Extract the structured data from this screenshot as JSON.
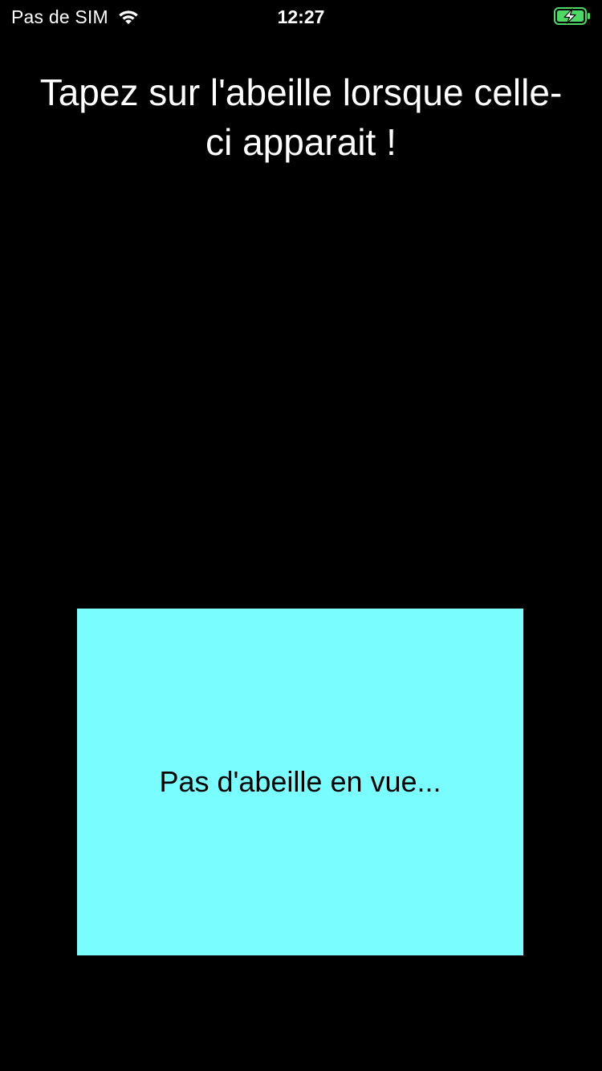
{
  "status_bar": {
    "carrier": "Pas de SIM",
    "time": "12:27",
    "wifi_icon": "wifi-icon",
    "battery_icon": "battery-charging-icon",
    "battery_color": "#4cd964"
  },
  "main": {
    "instruction": "Tapez sur l'abeille lorsque celle-ci apparait !",
    "bee_zone": {
      "label": "Pas d'abeille en vue...",
      "background_color": "#7afdfe"
    }
  }
}
